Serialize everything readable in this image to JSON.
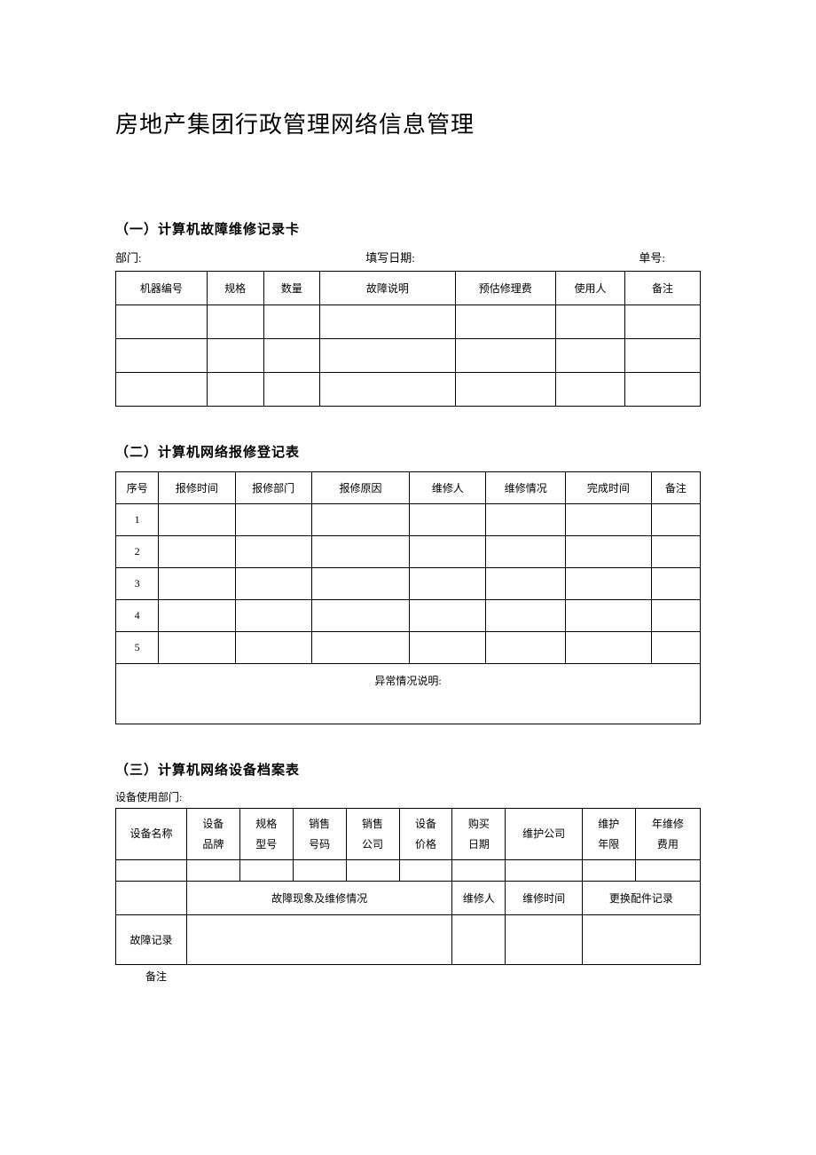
{
  "title": "房地产集团行政管理网络信息管理",
  "section1": {
    "title": "（一）计算机故障维修记录卡",
    "meta": {
      "dept_label": "部门:",
      "date_label": "填写日期:",
      "sheet_label": "单号:"
    },
    "headers": [
      "机器编号",
      "规格",
      "数量",
      "故障说明",
      "预估修理费",
      "使用人",
      "备注"
    ]
  },
  "section2": {
    "title": "（二）计算机网络报修登记表",
    "headers": [
      "序号",
      "报修时间",
      "报修部门",
      "报修原因",
      "维修人",
      "维修情况",
      "完成时间",
      "备注"
    ],
    "rows": [
      "1",
      "2",
      "3",
      "4",
      "5"
    ],
    "footer": "异常情况说明:"
  },
  "section3": {
    "title": "（三）计算机网络设备档案表",
    "meta": "设备使用部门:",
    "headers": [
      "设备名称",
      "设备\n品牌",
      "规格\n型号",
      "销售\n号码",
      "销售\n公司",
      "设备\n价格",
      "购买\n日期",
      "维护公司",
      "维护\n年限",
      "年维修\n费用"
    ],
    "sub": {
      "fault_status": "故障现象及维修情况",
      "repairer": "维修人",
      "repair_time": "维修时间",
      "parts": "更换配件记录",
      "fault_record": "故障记录"
    },
    "footnote": "备注"
  }
}
